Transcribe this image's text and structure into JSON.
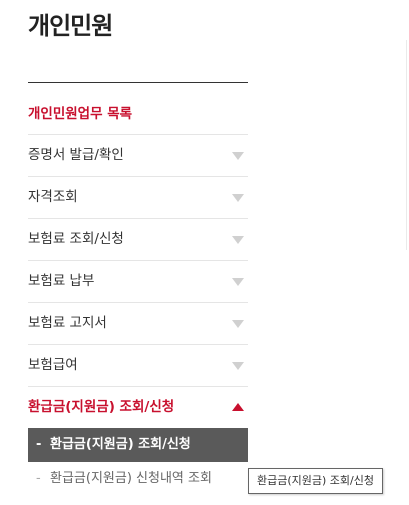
{
  "page": {
    "title": "개인민원"
  },
  "menu": {
    "heading": "개인민원업무 목록",
    "items": [
      {
        "label": "증명서 발급/확인"
      },
      {
        "label": "자격조회"
      },
      {
        "label": "보험료 조회/신청"
      },
      {
        "label": "보험료 납부"
      },
      {
        "label": "보험료 고지서"
      },
      {
        "label": "보험급여"
      },
      {
        "label": "환급금(지원금) 조회/신청"
      }
    ]
  },
  "submenu": {
    "items": [
      {
        "label": "환급금(지원금) 조회/신청"
      },
      {
        "label": "환급금(지원금) 신청내역 조회"
      }
    ]
  },
  "tooltip": {
    "text": "환급금(지원금) 조회/신청"
  },
  "colors": {
    "accent": "#c8102e",
    "active_bg": "#5a5a5a"
  }
}
